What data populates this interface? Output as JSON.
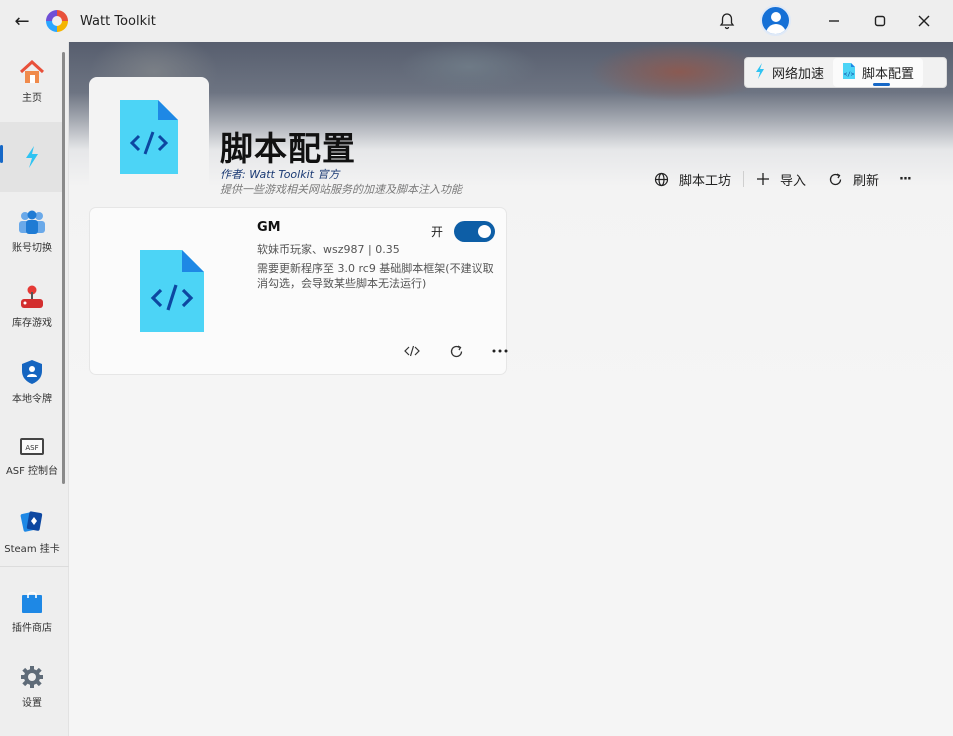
{
  "app": {
    "title": "Watt Toolkit"
  },
  "sidebar": {
    "items": [
      {
        "label": "主页",
        "icon": "home-icon"
      },
      {
        "label": "",
        "icon": "lightning-icon"
      },
      {
        "label": "账号切换",
        "icon": "users-icon"
      },
      {
        "label": "库存游戏",
        "icon": "joystick-icon"
      },
      {
        "label": "本地令牌",
        "icon": "shield-icon"
      },
      {
        "label": "ASF 控制台",
        "icon": "asf-icon"
      },
      {
        "label": "Steam 挂卡",
        "icon": "cards-icon"
      },
      {
        "label": "插件商店",
        "icon": "store-icon"
      },
      {
        "label": "设置",
        "icon": "gear-icon"
      }
    ]
  },
  "tabs": [
    {
      "label": "网络加速"
    },
    {
      "label": "脚本配置"
    }
  ],
  "header": {
    "title": "脚本配置",
    "author": "作者:  Watt Toolkit  官方",
    "description": "提供一些游戏相关网站服务的加速及脚本注入功能"
  },
  "toolbar": {
    "workshop": "脚本工坊",
    "import": "导入",
    "refresh": "刷新",
    "more": "···"
  },
  "script_card": {
    "title": "GM",
    "meta": "软妹币玩家、wsz987 | 0.35",
    "description": "需要更新程序至 3.0 rc9 基础脚本框架(不建议取消勾选，会导致某些脚本无法运行)",
    "toggle_label": "开",
    "enabled": true
  },
  "colors": {
    "accent": "#1668c7",
    "toggle": "#0d5ea6",
    "script_icon": "#4cd4f6"
  }
}
